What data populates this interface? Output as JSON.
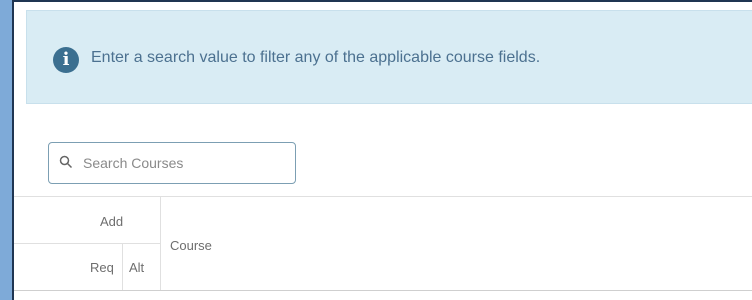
{
  "alert": {
    "icon": "info-circle-icon",
    "message": "Enter a search value to filter any of the applicable course fields."
  },
  "search": {
    "icon": "search-icon",
    "placeholder": "Search Courses",
    "value": ""
  },
  "table": {
    "headers": {
      "group": "Add",
      "req": "Req",
      "alt": "Alt",
      "course": "Course"
    }
  },
  "colors": {
    "alert_background": "#d9ecf4",
    "alert_text": "#4c7190",
    "info_icon": "#3b6f90",
    "outer_background": "#7eaad8"
  }
}
